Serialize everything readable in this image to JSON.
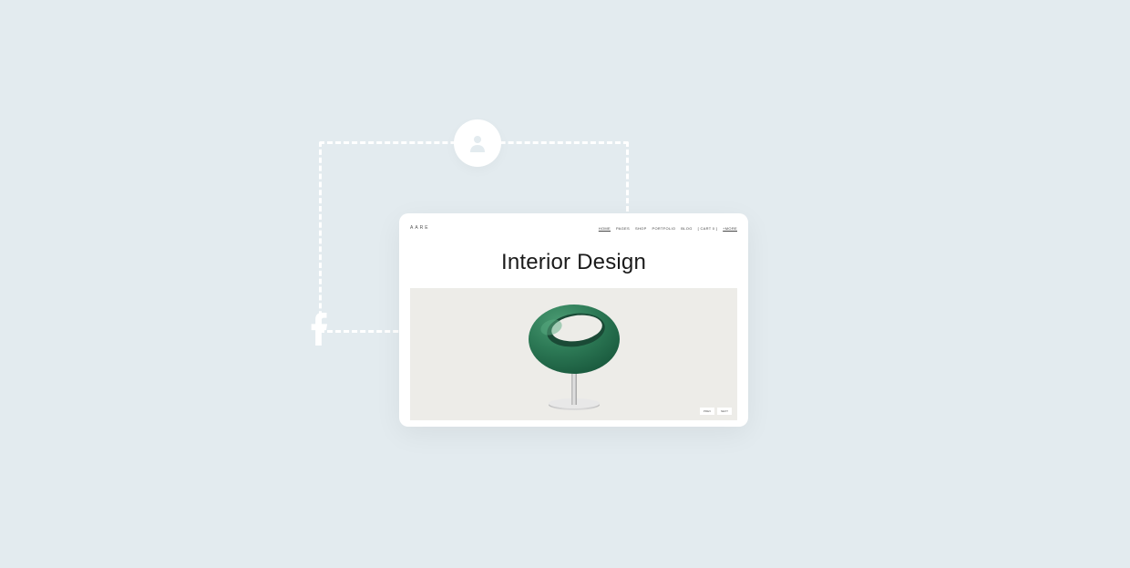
{
  "card": {
    "logo": "AARE",
    "nav": [
      "HOME",
      "PAGES",
      "SHOP",
      "PORTFOLIO",
      "BLOG",
      "[ CART 0 ]",
      "+MORE"
    ],
    "title": "Interior Design",
    "buttons": [
      "PREV",
      "NEXT"
    ]
  },
  "icons": {
    "profile": "profile-icon",
    "facebook": "facebook-icon"
  }
}
